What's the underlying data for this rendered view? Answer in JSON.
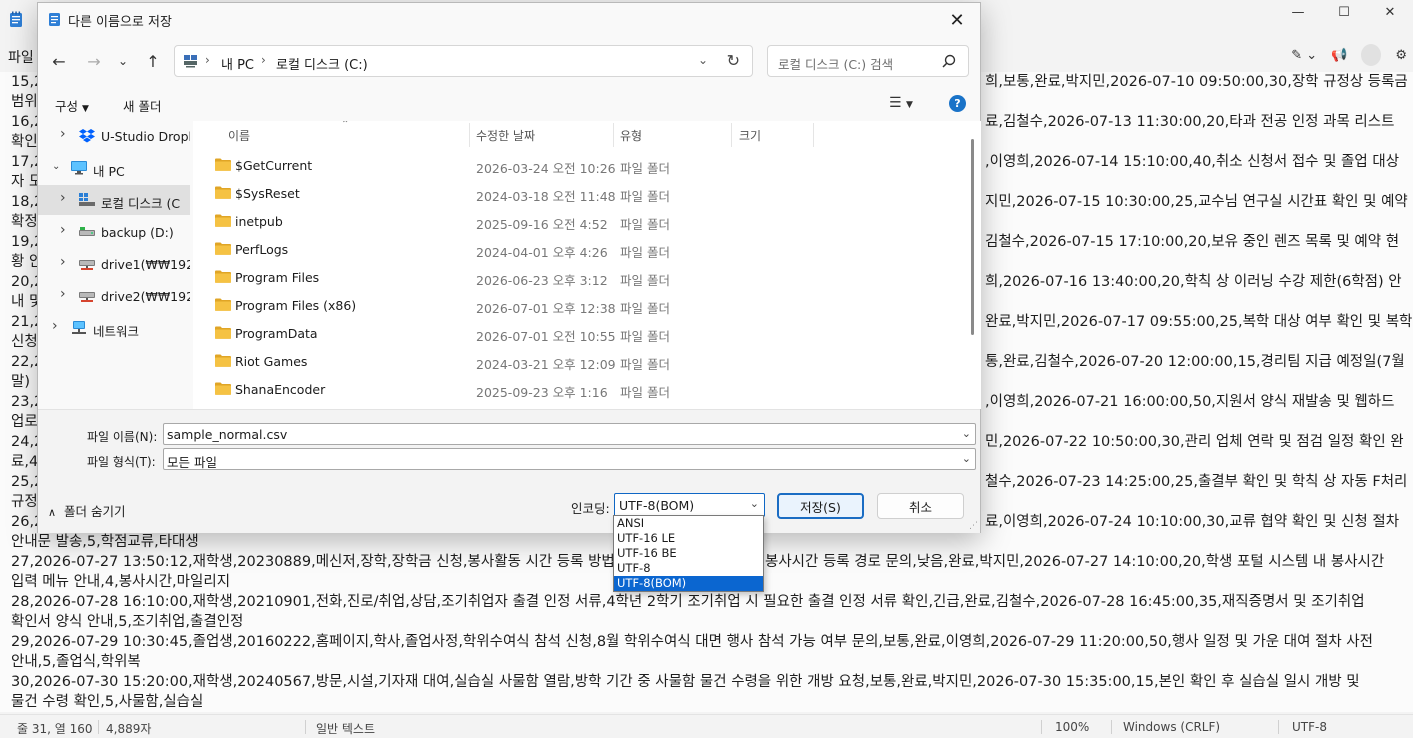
{
  "notepad": {
    "menu_file": "파일",
    "editor_lines": [
      "15,20",
      "범위",
      "16,2",
      "확인",
      "17,2",
      "자 모",
      "18,2",
      "확정",
      "19,2",
      "황 안",
      "20,2",
      "내 및",
      "21,2",
      "신청",
      "22,2",
      "말)",
      "23,2",
      "업로",
      "24,2",
      "료,4",
      "25,2",
      "규정",
      "26,2",
      "안내문 발송,5,학점교류,타대생",
      "27,2026-07-27 13:50:12,재학생,20230889,메신저,장학,장학금 신청,봉사활동 시간 등록 방법,",
      "입력 메뉴 안내,4,봉사시간,마일리지",
      "28,2026-07-28 16:10:00,재학생,20210901,전화,진로/취업,상담,조기취업자 출결 인정 서류,4학년 2학기 조기취업 시 필요한 출결 인정 서류 확인,긴급,완료,김철수,2026-07-28 16:45:00,35,재직증명서 및 조기취업",
      "확인서 양식 안내,5,조기취업,출결인정",
      "29,2026-07-29 10:30:45,졸업생,20160222,홈페이지,학사,졸업사정,학위수여식 참석 신청,8월 학위수여식 대면 행사 참석 가능 여부 문의,보통,완료,이영희,2026-07-29 11:20:00,50,행사 일정 및 가운 대여 절차 사전",
      "안내,5,졸업식,학위복",
      "30,2026-07-30 15:20:00,재학생,20240567,방문,시설,기자재 대여,실습실 사물함 열람,방학 기간 중 사물함 물건 수령을 위한 개방 요청,보통,완료,박지민,2026-07-30 15:35:00,15,본인 확인 후 실습실 일시 개방 및",
      "물건 수령 확인,5,사물함,실습실"
    ],
    "editor_right_fragments": [
      "희,보통,완료,박지민,2026-07-10 09:50:00,30,장학 규정상 등록금",
      "",
      "료,김철수,2026-07-13 11:30:00,20,타과 전공 인정 과목 리스트",
      "",
      ",이영희,2026-07-14 15:10:00,40,취소 신청서 접수 및 졸업 대상",
      "",
      "지민,2026-07-15 10:30:00,25,교수님 연구실 시간표 확인 및 예약",
      "",
      "김철수,2026-07-15 17:10:00,20,보유 중인 렌즈 목록 및 예약 현",
      "",
      "희,2026-07-16 13:40:00,20,학칙 상 이러닝 수강 제한(6학점) 안",
      "",
      "완료,박지민,2026-07-17 09:55:00,25,복학 대상 여부 확인 및 복학",
      "",
      "통,완료,김철수,2026-07-20 12:00:00,15,경리팀 지급 예정일(7월",
      "",
      ",이영희,2026-07-21 16:00:00,50,지원서 양식 재발송 및 웹하드",
      "",
      "민,2026-07-22 10:50:00,30,관리 업체 연락 및 점검 일정 확인 완",
      "",
      "철수,2026-07-23 14:25:00,25,출결부 확인 및 학칙 상 자동 F처리",
      "",
      "료,이영희,2026-07-24 10:10:00,30,교류 협약 확인 및 신청 절차",
      "",
      "봉사시간 등록 경로 문의,낮음,완료,박지민,2026-07-27 14:10:00,20,학생 포털 시스템 내 봉사시간"
    ],
    "status": {
      "position": "줄 31, 열 160",
      "chars": "4,889자",
      "format": "일반 텍스트",
      "zoom": "100%",
      "line_ending": "Windows (CRLF)",
      "encoding": "UTF-8"
    }
  },
  "dialog": {
    "title": "다른 이름으로 저장",
    "address": {
      "part1": "내 PC",
      "part2": "로컬 디스크 (C:)"
    },
    "search_placeholder": "로컬 디스크 (C:) 검색",
    "toolbar": {
      "organize": "구성",
      "new_folder": "새 폴더"
    },
    "nav_tree": [
      {
        "label": "U-Studio Dropb",
        "icon": "dropbox-icon",
        "indent": 1,
        "expandable": true,
        "expanded": false
      },
      {
        "label": "내 PC",
        "icon": "monitor-icon",
        "indent": 0,
        "expandable": true,
        "expanded": true
      },
      {
        "label": "로컬 디스크 (C",
        "icon": "windows-drive-icon",
        "indent": 1,
        "expandable": true,
        "expanded": false,
        "selected": true
      },
      {
        "label": "backup (D:)",
        "icon": "drive-icon",
        "indent": 1,
        "expandable": true,
        "expanded": false
      },
      {
        "label": "drive1(₩₩192",
        "icon": "network-drive-icon",
        "indent": 1,
        "expandable": true,
        "expanded": false
      },
      {
        "label": "drive2(₩₩192",
        "icon": "network-drive-icon",
        "indent": 1,
        "expandable": true,
        "expanded": false
      },
      {
        "label": "네트워크",
        "icon": "network-icon",
        "indent": 0,
        "expandable": true,
        "expanded": false
      }
    ],
    "columns": {
      "name": "이름",
      "date": "수정한 날짜",
      "type": "유형",
      "size": "크기"
    },
    "files": [
      {
        "name": "$GetCurrent",
        "date": "2026-03-24 오전 10:26",
        "type": "파일 폴더"
      },
      {
        "name": "$SysReset",
        "date": "2024-03-18 오전 11:48",
        "type": "파일 폴더"
      },
      {
        "name": "inetpub",
        "date": "2025-09-16 오전 4:52",
        "type": "파일 폴더"
      },
      {
        "name": "PerfLogs",
        "date": "2024-04-01 오후 4:26",
        "type": "파일 폴더"
      },
      {
        "name": "Program Files",
        "date": "2026-06-23 오후 3:12",
        "type": "파일 폴더"
      },
      {
        "name": "Program Files (x86)",
        "date": "2026-07-01 오후 12:38",
        "type": "파일 폴더"
      },
      {
        "name": "ProgramData",
        "date": "2026-07-01 오전 10:55",
        "type": "파일 폴더"
      },
      {
        "name": "Riot Games",
        "date": "2024-03-21 오후 12:09",
        "type": "파일 폴더"
      },
      {
        "name": "ShanaEncoder",
        "date": "2025-09-23 오후 1:16",
        "type": "파일 폴더"
      }
    ],
    "filename_label": "파일 이름(N):",
    "filename_value": "sample_normal.csv",
    "filetype_label": "파일 형식(T):",
    "filetype_value": "모든 파일",
    "hide_folders": "폴더 숨기기",
    "encoding_label": "인코딩:",
    "encoding_value": "UTF-8(BOM)",
    "encoding_options": [
      "ANSI",
      "UTF-16 LE",
      "UTF-16 BE",
      "UTF-8",
      "UTF-8(BOM)"
    ],
    "encoding_selected_index": 4,
    "save_button": "저장(S)",
    "cancel_button": "취소"
  },
  "colors": {
    "accent": "#0b66d0",
    "folder": "#f5c243",
    "folder_dark": "#e0a526"
  }
}
